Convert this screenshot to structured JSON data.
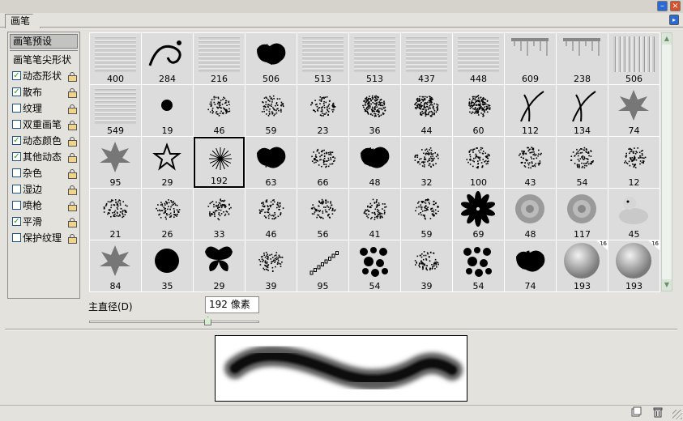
{
  "window": {
    "minimize_icon": "minimize-icon",
    "close_icon": "close-icon",
    "close_glyph": "×"
  },
  "panel": {
    "tab_label": "画笔",
    "menu_icon": "triangle-right-icon",
    "menu_glyph": "▸"
  },
  "sidebar": {
    "header": "画笔预设",
    "items": [
      {
        "label": "画笔笔尖形状",
        "checkbox": false,
        "checked": false,
        "lock": false
      },
      {
        "label": "动态形状",
        "checkbox": true,
        "checked": true,
        "lock": true
      },
      {
        "label": "散布",
        "checkbox": true,
        "checked": true,
        "lock": true
      },
      {
        "label": "纹理",
        "checkbox": true,
        "checked": false,
        "lock": true
      },
      {
        "label": "双重画笔",
        "checkbox": true,
        "checked": false,
        "lock": true
      },
      {
        "label": "动态颜色",
        "checkbox": true,
        "checked": true,
        "lock": true
      },
      {
        "label": "其他动态",
        "checkbox": true,
        "checked": true,
        "lock": true
      },
      {
        "label": "杂色",
        "checkbox": true,
        "checked": false,
        "lock": true
      },
      {
        "label": "湿边",
        "checkbox": true,
        "checked": false,
        "lock": true
      },
      {
        "label": "喷枪",
        "checkbox": true,
        "checked": false,
        "lock": true
      },
      {
        "label": "平滑",
        "checkbox": true,
        "checked": true,
        "lock": true
      },
      {
        "label": "保护纹理",
        "checkbox": true,
        "checked": false,
        "lock": true
      }
    ],
    "check_glyph": "✓"
  },
  "brushes": [
    {
      "size": "400",
      "kind": "texture"
    },
    {
      "size": "284",
      "kind": "swirl"
    },
    {
      "size": "216",
      "kind": "texture"
    },
    {
      "size": "506",
      "kind": "splat"
    },
    {
      "size": "513",
      "kind": "texture"
    },
    {
      "size": "513",
      "kind": "texture"
    },
    {
      "size": "437",
      "kind": "texture"
    },
    {
      "size": "448",
      "kind": "texture"
    },
    {
      "size": "609",
      "kind": "drip"
    },
    {
      "size": "238",
      "kind": "drip"
    },
    {
      "size": "506",
      "kind": "texture2"
    },
    {
      "size": "549",
      "kind": "texture"
    },
    {
      "size": "19",
      "kind": "dot"
    },
    {
      "size": "46",
      "kind": "speckle"
    },
    {
      "size": "59",
      "kind": "speckle"
    },
    {
      "size": "23",
      "kind": "speckle"
    },
    {
      "size": "36",
      "kind": "streak"
    },
    {
      "size": "44",
      "kind": "streak"
    },
    {
      "size": "60",
      "kind": "streak"
    },
    {
      "size": "112",
      "kind": "grass"
    },
    {
      "size": "134",
      "kind": "grass"
    },
    {
      "size": "74",
      "kind": "leaf"
    },
    {
      "size": "95",
      "kind": "leaf"
    },
    {
      "size": "29",
      "kind": "star"
    },
    {
      "size": "192",
      "kind": "starburst",
      "selected": true
    },
    {
      "size": "63",
      "kind": "splat"
    },
    {
      "size": "66",
      "kind": "speckle"
    },
    {
      "size": "48",
      "kind": "splat"
    },
    {
      "size": "32",
      "kind": "speckle"
    },
    {
      "size": "100",
      "kind": "speckle"
    },
    {
      "size": "43",
      "kind": "speckle"
    },
    {
      "size": "54",
      "kind": "speckle"
    },
    {
      "size": "12",
      "kind": "speckle"
    },
    {
      "size": "21",
      "kind": "speckle"
    },
    {
      "size": "26",
      "kind": "speckle"
    },
    {
      "size": "33",
      "kind": "speckle"
    },
    {
      "size": "46",
      "kind": "speckle"
    },
    {
      "size": "56",
      "kind": "speckle"
    },
    {
      "size": "41",
      "kind": "speckle"
    },
    {
      "size": "59",
      "kind": "speckle"
    },
    {
      "size": "69",
      "kind": "flower"
    },
    {
      "size": "48",
      "kind": "rose"
    },
    {
      "size": "117",
      "kind": "rose"
    },
    {
      "size": "45",
      "kind": "duck"
    },
    {
      "size": "84",
      "kind": "leaf"
    },
    {
      "size": "35",
      "kind": "bigdot"
    },
    {
      "size": "29",
      "kind": "butterfly"
    },
    {
      "size": "39",
      "kind": "speckle"
    },
    {
      "size": "95",
      "kind": "chain"
    },
    {
      "size": "54",
      "kind": "dots"
    },
    {
      "size": "39",
      "kind": "speckle"
    },
    {
      "size": "54",
      "kind": "dots"
    },
    {
      "size": "74",
      "kind": "splat"
    },
    {
      "size": "193",
      "kind": "sphere",
      "badge": "16"
    },
    {
      "size": "193",
      "kind": "sphere",
      "badge": "16"
    }
  ],
  "scrollbar": {
    "up_glyph": "▲",
    "down_glyph": "▼"
  },
  "diameter": {
    "label": "主直径(D)",
    "value": "192 像素",
    "slider_fraction": 0.7
  },
  "statusbar": {
    "new_icon": "new-brush-icon",
    "delete_icon": "trash-icon"
  }
}
